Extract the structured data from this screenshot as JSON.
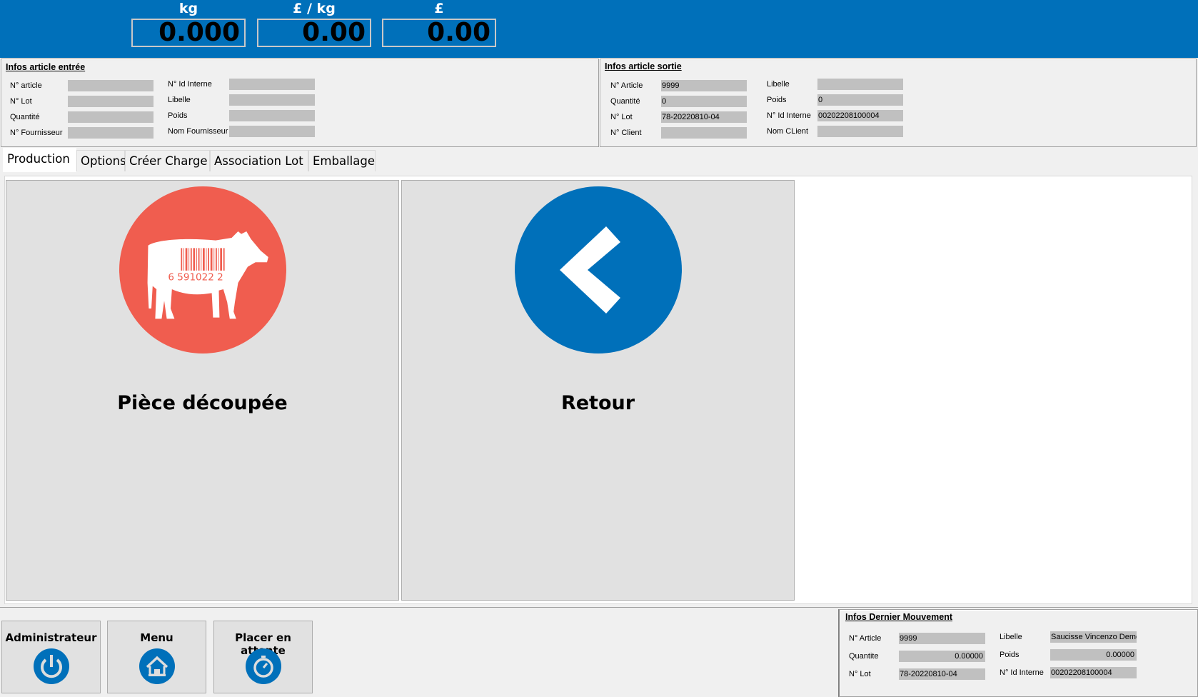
{
  "colors": {
    "header": "#0070ba",
    "cow_circle": "#f05d4f",
    "back_circle": "#0070ba"
  },
  "scale": {
    "weight_unit": "kg",
    "price_unit": "£ / kg",
    "total_unit": "£",
    "weight": "0.000",
    "price_per_kg": "0.00",
    "total": "0.00"
  },
  "entree": {
    "title": "Infos article entrée",
    "fields": [
      {
        "label": "N° article",
        "value": ""
      },
      {
        "label": "N° Lot",
        "value": ""
      },
      {
        "label": "Quantité",
        "value": ""
      },
      {
        "label": "N° Fournisseur",
        "value": ""
      },
      {
        "label": "N° Id Interne",
        "value": ""
      },
      {
        "label": "Libelle",
        "value": ""
      },
      {
        "label": "Poids",
        "value": ""
      },
      {
        "label": "Nom Fournisseur",
        "value": ""
      }
    ]
  },
  "sortie": {
    "title": "Infos article sortie",
    "fields": [
      {
        "label": "N° Article",
        "value": "9999"
      },
      {
        "label": "Quantité",
        "value": "0"
      },
      {
        "label": "N° Lot",
        "value": "78-20220810-04"
      },
      {
        "label": "N° Client",
        "value": ""
      },
      {
        "label": "Libelle",
        "value": ""
      },
      {
        "label": "Poids",
        "value": "0"
      },
      {
        "label": "N° Id Interne",
        "value": "00202208100004"
      },
      {
        "label": "Nom CLient",
        "value": ""
      }
    ]
  },
  "tabs": [
    {
      "label": "Production",
      "active": true
    },
    {
      "label": "Options"
    },
    {
      "label": "Créer Charge"
    },
    {
      "label": "Association Lot"
    },
    {
      "label": "Emballage"
    }
  ],
  "tiles": [
    {
      "label": "Pièce découpée",
      "icon": "cow-barcode-icon",
      "barcode_text": "6 591022 2"
    },
    {
      "label": "Retour",
      "icon": "chevron-left-icon"
    }
  ],
  "buttons": [
    {
      "label": "Administrateur",
      "icon": "power-icon"
    },
    {
      "label": "Menu",
      "icon": "home-icon"
    },
    {
      "label": "Placer en attente",
      "icon": "stopwatch-icon"
    }
  ],
  "dernier": {
    "title": "Infos Dernier Mouvement",
    "fields": [
      {
        "label": "N° Article",
        "value": "9999"
      },
      {
        "label": "Quantite",
        "value": "0.00000",
        "align": "right"
      },
      {
        "label": "N° Lot",
        "value": "78-20220810-04"
      },
      {
        "label": "Libelle",
        "value": "Saucisse Vincenzo Demo"
      },
      {
        "label": "Poids",
        "value": "0.00000",
        "align": "right"
      },
      {
        "label": "N° Id Interne",
        "value": "00202208100004"
      }
    ]
  }
}
